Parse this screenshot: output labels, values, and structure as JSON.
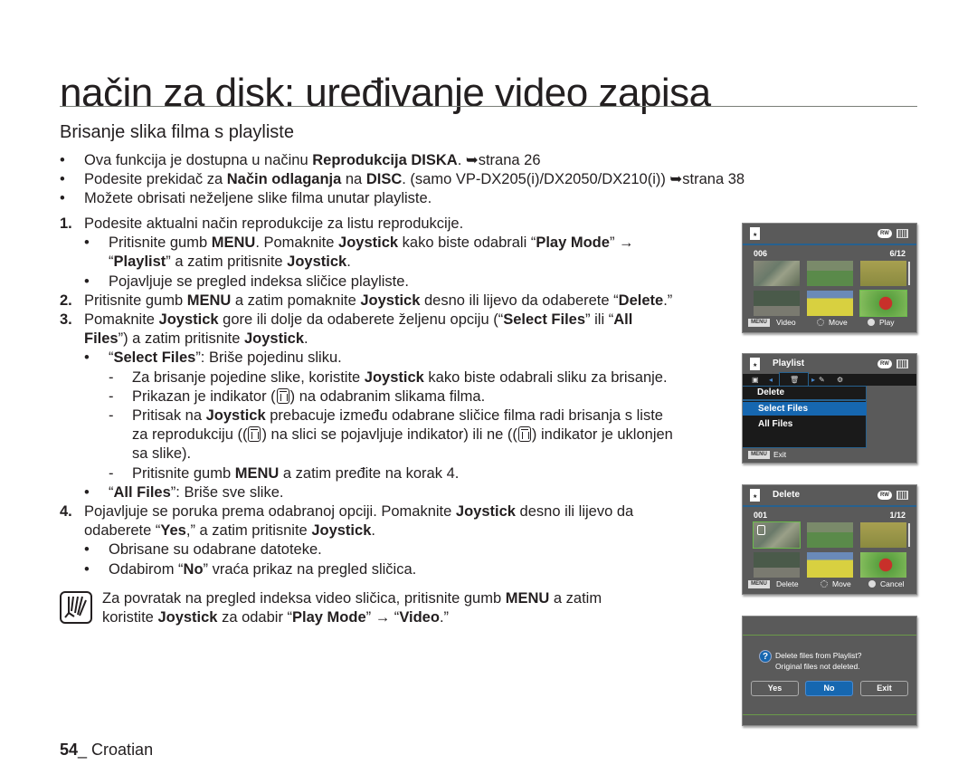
{
  "page": {
    "title": "način za disk: uređivanje video zapisa",
    "section_title": "Brisanje slika filma s playliste"
  },
  "intro": [
    {
      "pre": "Ova funkcija je dostupna u načinu ",
      "bold": "Reprodukcija DISKA",
      "post": ". ➥strana 26"
    },
    {
      "pre": "Podesite prekidač za ",
      "bold": "Način odlaganja",
      "mid": " na ",
      "bold2": "DISC",
      "post": ". (samo VP-DX205(i)/DX2050/DX210(i)) ➥strana 38"
    },
    {
      "pre": "Možete obrisati neželjene slike filma unutar playliste."
    }
  ],
  "steps": {
    "s1": {
      "num": "1.",
      "text": "Podesite aktualni način reprodukcije za listu reprodukcije.",
      "b1_a": "Pritisnite gumb ",
      "b1_menu": "MENU",
      "b1_b": ". Pomaknite ",
      "b1_joy": "Joystick",
      "b1_c": " kako biste odabrali “",
      "b1_pm": "Play Mode",
      "b1_d": "” → ",
      "b1_e": "“",
      "b1_pl": "Playlist",
      "b1_f": "” a zatim pritisnite ",
      "b1_joy2": "Joystick",
      "b1_g": ".",
      "b2": "Pojavljuje se pregled indeksa sličice playliste."
    },
    "s2": {
      "num": "2.",
      "a": "Pritisnite gumb ",
      "menu": "MENU",
      "b": " a zatim pomaknite ",
      "joy": "Joystick",
      "c": " desno ili lijevo da odaberete “",
      "del": "Delete",
      "d": ".”"
    },
    "s3": {
      "num": "3.",
      "a": "Pomaknite ",
      "joy": "Joystick",
      "b": " gore ili dolje da odaberete željenu opciju (“",
      "sf": "Select Files",
      "c": "” ili “",
      "all": "All",
      "l2_files": "Files",
      "l2_a": "”) a zatim pritisnite ",
      "l2_joy": "Joystick",
      "l2_b": ".",
      "sel_q1": "“",
      "sel": "Select Files",
      "sel_q2": "”: Briše pojedinu sliku.",
      "d1_a": "Za brisanje pojedine slike, koristite ",
      "d1_joy": "Joystick",
      "d1_b": " kako biste odabrali sliku za brisanje.",
      "d2_a": "Prikazan je indikator (",
      "d2_b": ") na odabranim slikama filma.",
      "d3_a": "Pritisak na ",
      "d3_joy": "Joystick",
      "d3_b": " prebacuje između odabrane sličice filma radi brisanja s liste",
      "d3_c": "za reprodukciju ((",
      "d3_d": ") na slici se pojavljuje indikator) ili ne ((",
      "d3_e": ") indikator je uklonjen",
      "d3_f": "sa slike).",
      "d4_a": "Pritisnite gumb ",
      "d4_menu": "MENU",
      "d4_b": " a zatim pređite na korak 4.",
      "all_q1": "“",
      "all_b": "All Files",
      "all_q2": "”: Briše sve slike."
    },
    "s4": {
      "num": "4.",
      "a": "Pojavljuje se poruka prema odabranoj opciji. Pomaknite ",
      "joy": "Joystick",
      "b": " desno ili lijevo da",
      "l2_a": "odaberete “",
      "yes": "Yes",
      "l2_b": ",” a zatim pritisnite ",
      "l2_joy": "Joystick",
      "l2_c": ".",
      "b1": "Obrisane su odabrane datoteke.",
      "b2_a": "Odabirom “",
      "b2_no": "No",
      "b2_b": "” vraća prikaz na pregled sličica."
    }
  },
  "note": {
    "l1_a": "Za povratak na pregled indeksa video sličica, pritisnite gumb ",
    "l1_menu": "MENU",
    "l1_b": " a zatim",
    "l2_a": "koristite ",
    "l2_joy": "Joystick",
    "l2_b": " za odabir “",
    "l2_pm": "Play Mode",
    "l2_c": "” → “",
    "l2_vid": "Video",
    "l2_d": ".”"
  },
  "footer": {
    "page_num": "54",
    "sep": "_ ",
    "language": "Croatian"
  },
  "screens": {
    "bullet": "•",
    "dash": "-",
    "common": {
      "rw_badge": "RW",
      "menu_key": "MENU"
    },
    "video_index": {
      "counter_left": "006",
      "counter_right": "6/12",
      "foot_menu": "Video",
      "foot_move": "Move",
      "foot_ok": "Play"
    },
    "playlist_menu": {
      "title": "Playlist",
      "menu_header": "Delete",
      "items": [
        "Select Files",
        "All Files"
      ],
      "selected_index": 0,
      "foot_menu": "Exit"
    },
    "delete_index": {
      "title": "Delete",
      "counter_left": "001",
      "counter_right": "1/12",
      "foot_menu": "Delete",
      "foot_move": "Move",
      "foot_ok": "Cancel"
    },
    "confirm": {
      "line1": "Delete files from Playlist?",
      "line2": "Original files not deleted.",
      "buttons": [
        "Yes",
        "No",
        "Exit"
      ],
      "focused": "No"
    }
  }
}
